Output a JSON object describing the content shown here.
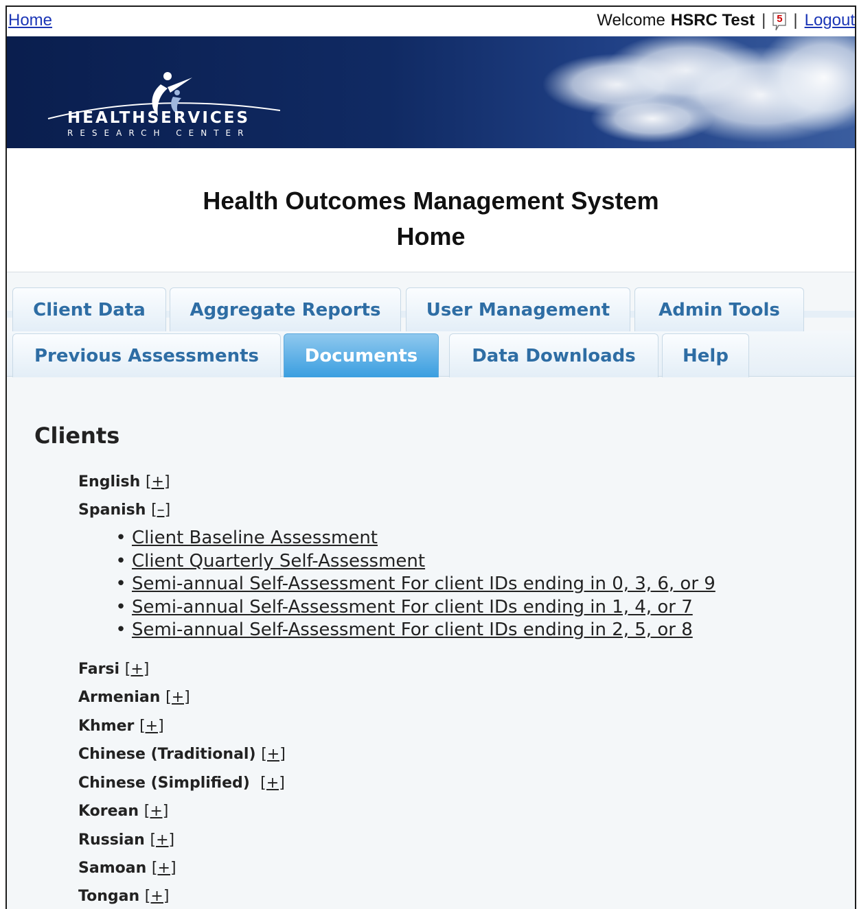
{
  "topbar": {
    "home_label": "Home",
    "welcome_text": "Welcome",
    "user_name": "HSRC Test",
    "separator": "|",
    "message_count": "5",
    "logout_label": "Logout"
  },
  "banner": {
    "logo_main": "HEALTHSERVICES",
    "logo_sub": "RESEARCH CENTER"
  },
  "page": {
    "title_line1": "Health Outcomes Management System",
    "title_line2": "Home"
  },
  "tabs": [
    {
      "label": "Client Data"
    },
    {
      "label": "Aggregate Reports"
    },
    {
      "label": "User Management"
    },
    {
      "label": "Admin Tools"
    },
    {
      "label": "Previous Assessments"
    },
    {
      "label": "Documents",
      "active": true
    },
    {
      "label": "Data Downloads"
    },
    {
      "label": "Help"
    }
  ],
  "content": {
    "heading": "Clients",
    "languages": [
      {
        "name": "English",
        "toggle": "[+]"
      },
      {
        "name": "Spanish",
        "toggle": "[–]"
      },
      {
        "name": "Farsi",
        "toggle": "[+]"
      },
      {
        "name": "Armenian",
        "toggle": "[+]"
      },
      {
        "name": "Khmer",
        "toggle": "[+]"
      },
      {
        "name": "Chinese (Traditional)",
        "toggle": "[+]"
      },
      {
        "name": "Chinese (Simplified) ",
        "toggle": "[+]"
      },
      {
        "name": "Korean",
        "toggle": "[+]"
      },
      {
        "name": "Russian",
        "toggle": "[+]"
      },
      {
        "name": "Samoan",
        "toggle": "[+]"
      },
      {
        "name": "Tongan",
        "toggle": "[+]"
      }
    ],
    "spanish_documents": [
      "Client Baseline Assessment",
      "Client Quarterly Self-Assessment",
      "Semi-annual Self-Assessment For client IDs ending in 0, 3, 6, or 9",
      "Semi-annual Self-Assessment For client IDs ending in 1, 4, or 7",
      "Semi-annual Self-Assessment For client IDs ending in 2, 5, or 8"
    ]
  },
  "colors": {
    "link": "#1a35b6",
    "tab_text": "#2e6da4",
    "active_tab": "#3a9ee0",
    "banner": "#102a63",
    "badge": "#cc0000"
  },
  "icons": {
    "message": "speech-bubble-icon"
  }
}
